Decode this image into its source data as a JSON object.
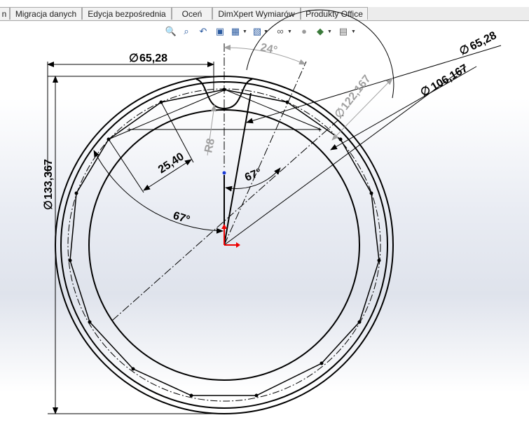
{
  "tabs": [
    "n",
    "Migracja danych",
    "Edycja bezpośrednia",
    "Oceń",
    "DimXpert Wymiarów",
    "Produkty Office"
  ],
  "toolbar_icons": [
    "zoom-to-fit-icon",
    "zoom-to-area-icon",
    "previous-view-icon",
    "section-view-icon",
    "view-orientation-icon",
    "display-style-icon",
    "hide-show-items-icon",
    "edit-appearance-icon",
    "apply-scene-icon",
    "view-settings-icon"
  ],
  "dimensions": {
    "top_diameter": "65,28",
    "right_diameter_outer": "65,28",
    "right_diameter_inner": "106,167",
    "pitch_diameter": "122,167",
    "left_diameter": "133,367",
    "angle_top": "24°",
    "angle_left": "67°",
    "angle_center": "67°",
    "radius": "R8",
    "length": "25,40"
  },
  "symbols": {
    "diameter": "∅"
  }
}
